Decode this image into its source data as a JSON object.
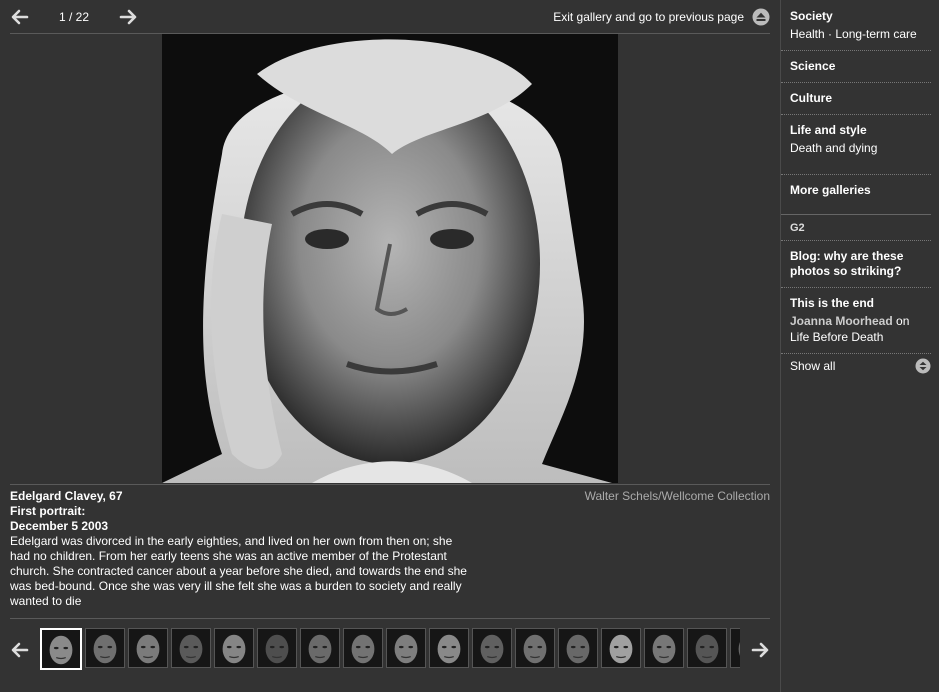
{
  "gallery": {
    "counter": "1 / 22",
    "exit_label": "Exit gallery and go to previous page"
  },
  "caption": {
    "name": "Edelgard Clavey, 67",
    "portrait_label": "First portrait:",
    "portrait_date": "December 5 2003",
    "description": "Edelgard was divorced in the early eighties, and lived on her own from then on; she had no children. From her early teens she was an active member of the Protestant church. She contracted cancer about a year before she died, and towards the end she was bed-bound. Once she was very ill she felt she was a burden to society and really wanted to die",
    "credit": "Walter Schels/Wellcome Collection"
  },
  "sidebar": {
    "society": {
      "title": "Society",
      "sub": "Health · Long-term care"
    },
    "science": {
      "title": "Science"
    },
    "culture": {
      "title": "Culture"
    },
    "life": {
      "title": "Life and style",
      "sub": "Death and dying"
    },
    "more": {
      "title": "More galleries"
    },
    "g2": {
      "label": "G2"
    },
    "blog": {
      "title": "Blog: why are these photos so striking?"
    },
    "end": {
      "title": "This is the end",
      "author": "Joanna Moorhead",
      "on": "on",
      "subject": "Life Before Death"
    },
    "show_all": "Show all"
  },
  "thumbnails": {
    "count": 17,
    "active_index": 0
  },
  "colors": {
    "background": "#333333",
    "rule": "#5a5a5a",
    "credit": "#aaaaaa"
  },
  "icons": {
    "prev": "arrow-left-icon",
    "next": "arrow-right-icon",
    "exit": "eject-circle-icon",
    "show_all": "expand-circle-icon"
  }
}
